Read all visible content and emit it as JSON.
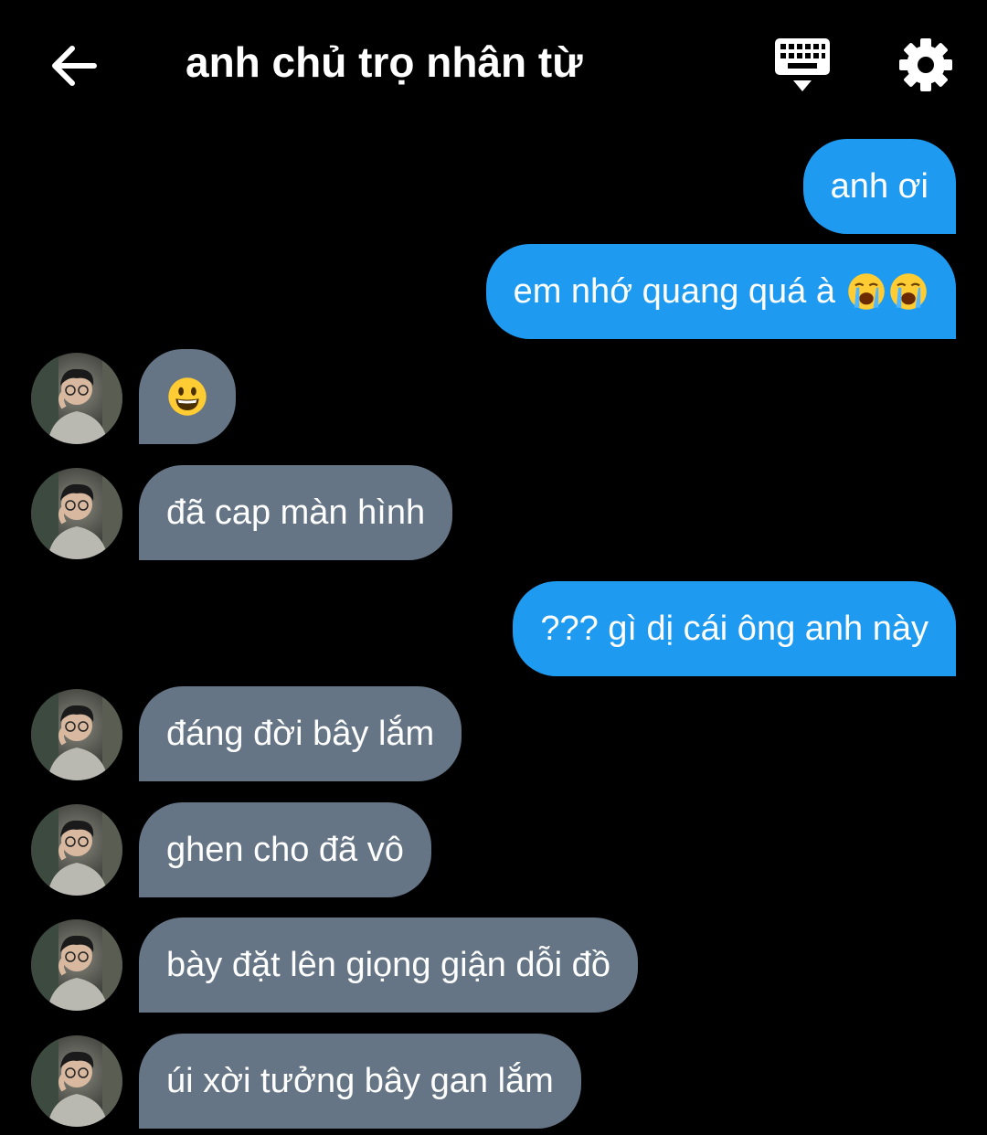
{
  "header": {
    "title": "anh chủ trọ nhân từ",
    "back_icon": "arrow-left-icon",
    "keyboard_icon": "keyboard-icon",
    "settings_icon": "gear-icon"
  },
  "colors": {
    "background": "#000000",
    "sent_bubble": "#1e9bf0",
    "received_bubble": "#657585",
    "text": "#ffffff"
  },
  "messages": [
    {
      "side": "sent",
      "text": "anh ơi"
    },
    {
      "side": "sent",
      "text": "em nhớ quang quá à",
      "emoji": [
        "loudly-crying-face",
        "loudly-crying-face"
      ]
    },
    {
      "side": "received",
      "text": "",
      "emoji": [
        "grinning-face"
      ]
    },
    {
      "side": "received",
      "text": "đã cap màn hình"
    },
    {
      "side": "sent",
      "text": "??? gì dị cái ông anh này"
    },
    {
      "side": "received",
      "text": "đáng đời bây lắm"
    },
    {
      "side": "received",
      "text": "ghen cho đã vô"
    },
    {
      "side": "received",
      "text": "bày đặt lên giọng giận dỗi đồ"
    },
    {
      "side": "received",
      "text": "úi xời tưởng bây gan lắm"
    }
  ]
}
